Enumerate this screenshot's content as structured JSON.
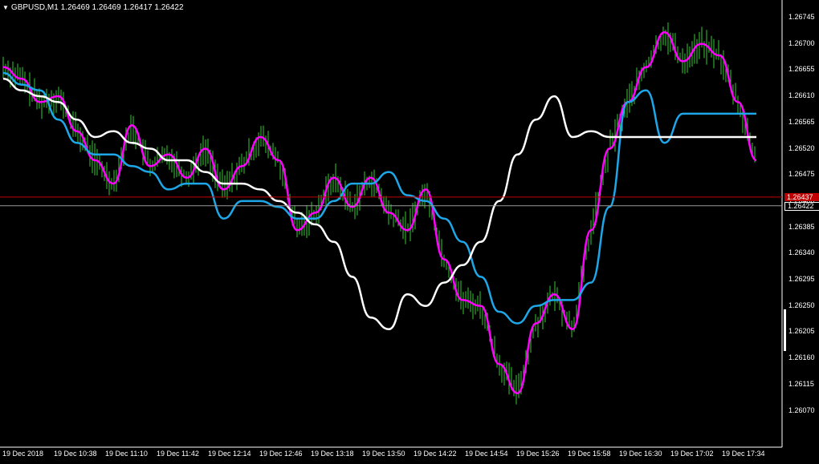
{
  "window": {
    "symbol_header": "GBPUSD,M1  1.26469 1.26469 1.26417 1.26422",
    "header_triangle": "▼"
  },
  "colors": {
    "background": "#000000",
    "candles": "#32cd32",
    "fast_line": "#ff00ff",
    "mid_line": "#1ea7e8",
    "slow_line": "#ffffff",
    "ask_line": "#c00000",
    "bid_line": "#808080",
    "axis_text": "#ffffff"
  },
  "price_axis": {
    "labels": [
      "1.26745",
      "1.26700",
      "1.26655",
      "1.26610",
      "1.26565",
      "1.26520",
      "1.26475",
      "1.26430",
      "1.26385",
      "1.26340",
      "1.26295",
      "1.26250",
      "1.26205",
      "1.26160",
      "1.26115",
      "1.26070"
    ]
  },
  "price_tags": {
    "ask": "1.26437",
    "bid": "1.26422"
  },
  "time_axis": {
    "labels": [
      "19 Dec 2018",
      "19 Dec 10:38",
      "19 Dec 11:10",
      "19 Dec 11:42",
      "19 Dec 12:14",
      "19 Dec 12:46",
      "19 Dec 13:18",
      "19 Dec 13:50",
      "19 Dec 14:22",
      "19 Dec 14:54",
      "19 Dec 15:26",
      "19 Dec 15:58",
      "19 Dec 16:30",
      "19 Dec 17:02",
      "19 Dec 17:34"
    ]
  },
  "chart_data": {
    "type": "line",
    "symbol": "GBPUSD",
    "timeframe": "M1",
    "ylim": [
      1.26055,
      1.26765
    ],
    "ask": 1.26437,
    "bid": 1.26422,
    "x": [
      "19 Dec 2018",
      "19 Dec 10:38",
      "19 Dec 11:10",
      "19 Dec 11:42",
      "19 Dec 12:14",
      "19 Dec 12:46",
      "19 Dec 13:18",
      "19 Dec 13:50",
      "19 Dec 14:22",
      "19 Dec 14:54",
      "19 Dec 15:26",
      "19 Dec 15:58",
      "19 Dec 16:30",
      "19 Dec 17:02",
      "19 Dec 17:34"
    ],
    "series": [
      {
        "color": "#ff00ff",
        "values": [
          1.2666,
          1.2664,
          1.266,
          1.2661,
          1.2655,
          1.265,
          1.2646,
          1.2656,
          1.2649,
          1.2651,
          1.2647,
          1.2652,
          1.2645,
          1.2649,
          1.2654,
          1.265,
          1.2638,
          1.2641,
          1.2647,
          1.2642,
          1.2647,
          1.2641,
          1.2638,
          1.2645,
          1.2633,
          1.2626,
          1.2625,
          1.2615,
          1.261,
          1.2622,
          1.2627,
          1.2621,
          1.2638,
          1.2652,
          1.266,
          1.2666,
          1.2672,
          1.2667,
          1.267,
          1.2668,
          1.266,
          1.265
        ]
      },
      {
        "color": "#1ea7e8",
        "values": [
          1.2665,
          1.2663,
          1.2662,
          1.2657,
          1.2653,
          1.2651,
          1.2651,
          1.2649,
          1.2648,
          1.2645,
          1.2646,
          1.2646,
          1.264,
          1.2643,
          1.2643,
          1.2642,
          1.264,
          1.264,
          1.2643,
          1.2646,
          1.2646,
          1.2648,
          1.2644,
          1.2643,
          1.264,
          1.2636,
          1.263,
          1.2624,
          1.2622,
          1.2625,
          1.2626,
          1.2626,
          1.2629,
          1.2642,
          1.266,
          1.2662,
          1.2653,
          1.2658,
          1.2658,
          1.2658,
          1.2658,
          1.2658
        ]
      },
      {
        "color": "#ffffff",
        "values": [
          1.2664,
          1.2662,
          1.2661,
          1.266,
          1.2657,
          1.2654,
          1.2655,
          1.2653,
          1.2652,
          1.265,
          1.265,
          1.2648,
          1.2646,
          1.2646,
          1.2645,
          1.2643,
          1.2641,
          1.2639,
          1.2636,
          1.263,
          1.2623,
          1.2621,
          1.2627,
          1.2625,
          1.2629,
          1.2632,
          1.2636,
          1.2643,
          1.2651,
          1.2657,
          1.2661,
          1.2654,
          1.2655,
          1.2654,
          1.2654,
          1.2654,
          1.2654,
          1.2654,
          1.2654,
          1.2654,
          1.2654,
          1.2654
        ]
      }
    ]
  }
}
